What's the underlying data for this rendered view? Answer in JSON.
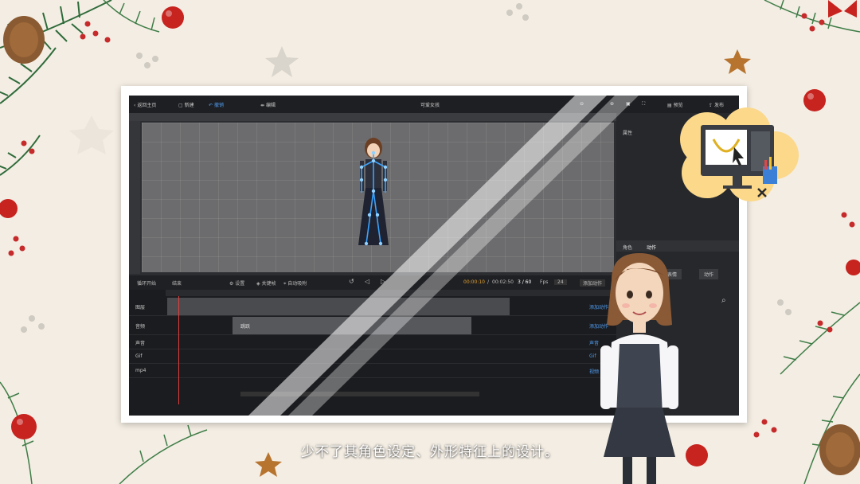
{
  "toolbar": {
    "home_label": "返回主页",
    "new_label": "新建",
    "undo_label": "撤销",
    "edit_label": "编辑",
    "title": "可爱女孩",
    "preview_label": "预览",
    "publish_label": "发布"
  },
  "controls": {
    "timeline_label": "循环开始",
    "frame_label": "结束",
    "settings_label": "设置",
    "keyframe_label": "关键帧",
    "auto_label": "自动吸附",
    "time_current": "00:00:10",
    "time_total": "00:02:50",
    "frame_counter": "3 / 60",
    "fps_label": "Fps",
    "fps_value": "24",
    "add_action_label": "添加动作"
  },
  "timeline": {
    "tracks": [
      {
        "label": "图层",
        "add_label": "添加动作"
      },
      {
        "label": "音频",
        "add_label": "添加动作"
      },
      {
        "label": "声音",
        "add_label": "声音"
      },
      {
        "label": "Gif",
        "add_label": "Gif"
      },
      {
        "label": "mp4",
        "add_label": "视频"
      }
    ],
    "clip_label": "跳跃"
  },
  "right_panel": {
    "title": "属性",
    "tab_1": "角色",
    "tab_2": "动作",
    "btn_1": "表情",
    "btn_2": "动作"
  },
  "subtitle": "少不了其角色设定、外形特征上的设计。",
  "colors": {
    "accent": "#4f9df2",
    "playhead": "#e23d3d",
    "badge": "#fbd88a"
  },
  "icons": [
    "pine-branch-icon",
    "ornament-ball-icon",
    "star-cookie-icon",
    "monitor-design-icon",
    "presenter-avatar"
  ]
}
